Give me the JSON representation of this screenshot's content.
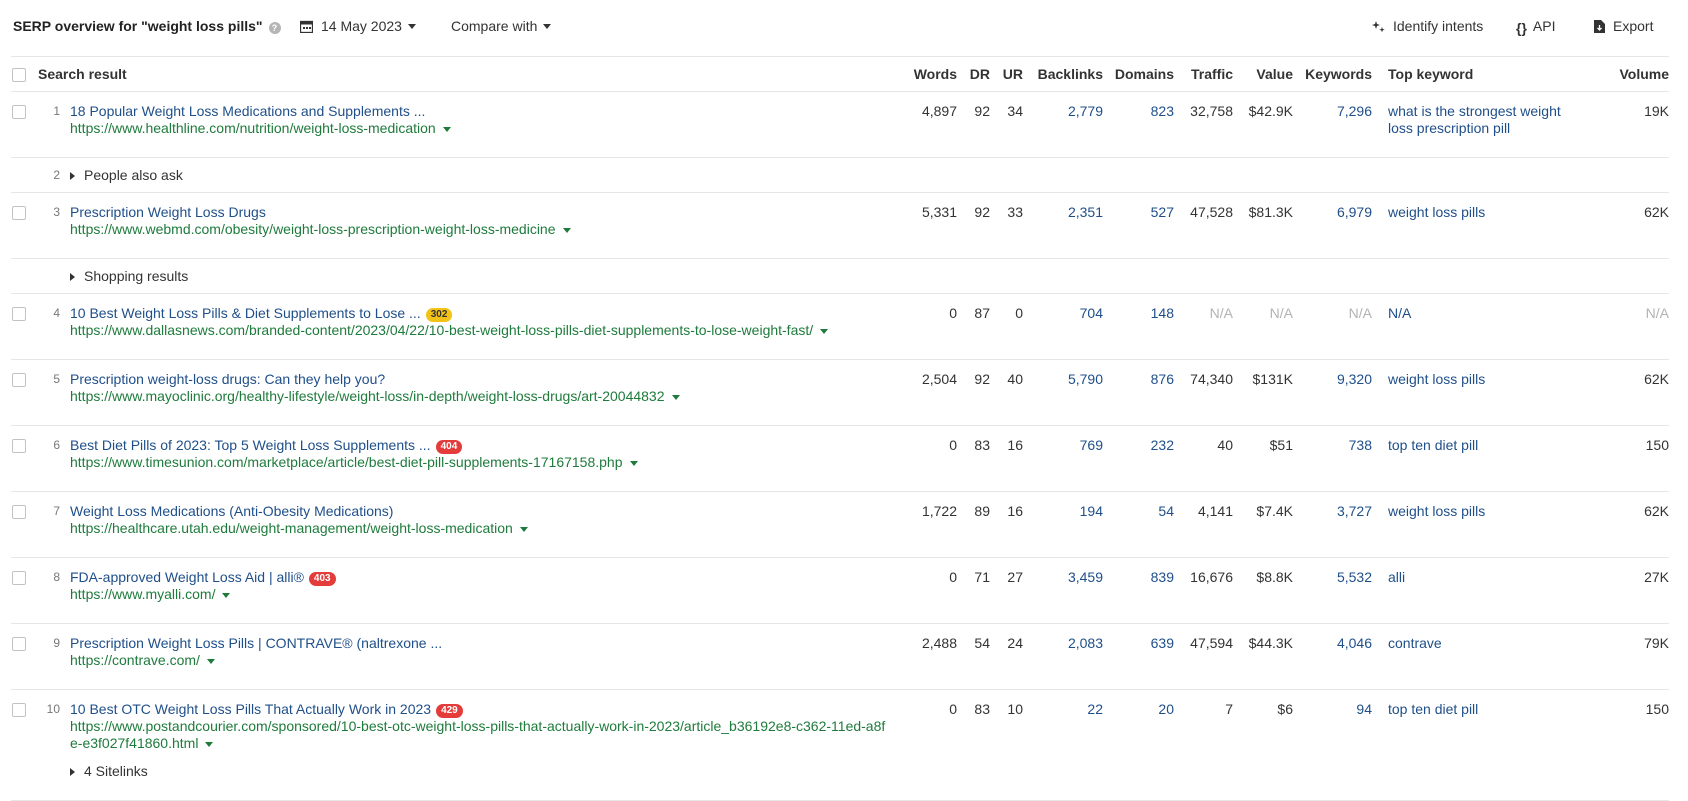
{
  "toolbar": {
    "title": "SERP overview for \"weight loss pills\"",
    "help": "?",
    "date": "14 May 2023",
    "compare": "Compare with",
    "identify": "Identify intents",
    "api": "API",
    "export": "Export"
  },
  "columns": {
    "result": "Search result",
    "words": "Words",
    "dr": "DR",
    "ur": "UR",
    "backlinks": "Backlinks",
    "domains": "Domains",
    "traffic": "Traffic",
    "value": "Value",
    "keywords": "Keywords",
    "top_keyword": "Top keyword",
    "volume": "Volume"
  },
  "rows": [
    {
      "num": "1",
      "title": "18 Popular Weight Loss Medications and Supplements ...",
      "url": "https://www.healthline.com/nutrition/weight-loss-medication",
      "words": "4,897",
      "dr": "92",
      "ur": "34",
      "backlinks": "2,779",
      "domains": "823",
      "traffic": "32,758",
      "value": "$42.9K",
      "keywords": "7,296",
      "top_keyword": "what is the strongest weight loss prescription pill",
      "volume": "19K"
    },
    {
      "num": "2",
      "label": "People also ask"
    },
    {
      "num": "3",
      "title": "Prescription Weight Loss Drugs",
      "url": "https://www.webmd.com/obesity/weight-loss-prescription-weight-loss-medicine",
      "words": "5,331",
      "dr": "92",
      "ur": "33",
      "backlinks": "2,351",
      "domains": "527",
      "traffic": "47,528",
      "value": "$81.3K",
      "keywords": "6,979",
      "top_keyword": "weight loss pills",
      "volume": "62K"
    },
    {
      "num": "",
      "label": "Shopping results"
    },
    {
      "num": "4",
      "title": "10 Best Weight Loss Pills & Diet Supplements to Lose ...",
      "badge": "302",
      "url": "https://www.dallasnews.com/branded-content/2023/04/22/10-best-weight-loss-pills-diet-supplements-to-lose-weight-fast/",
      "words": "0",
      "dr": "87",
      "ur": "0",
      "backlinks": "704",
      "domains": "148",
      "traffic": "N/A",
      "value": "N/A",
      "keywords": "N/A",
      "top_keyword": "N/A",
      "volume": "N/A"
    },
    {
      "num": "5",
      "title": "Prescription weight-loss drugs: Can they help you?",
      "url": "https://www.mayoclinic.org/healthy-lifestyle/weight-loss/in-depth/weight-loss-drugs/art-20044832",
      "words": "2,504",
      "dr": "92",
      "ur": "40",
      "backlinks": "5,790",
      "domains": "876",
      "traffic": "74,340",
      "value": "$131K",
      "keywords": "9,320",
      "top_keyword": "weight loss pills",
      "volume": "62K"
    },
    {
      "num": "6",
      "title": "Best Diet Pills of 2023: Top 5 Weight Loss Supplements ...",
      "badge": "404",
      "url": "https://www.timesunion.com/marketplace/article/best-diet-pill-supplements-17167158.php",
      "words": "0",
      "dr": "83",
      "ur": "16",
      "backlinks": "769",
      "domains": "232",
      "traffic": "40",
      "value": "$51",
      "keywords": "738",
      "top_keyword": "top ten diet pill",
      "volume": "150"
    },
    {
      "num": "7",
      "title": "Weight Loss Medications (Anti-Obesity Medications)",
      "url": "https://healthcare.utah.edu/weight-management/weight-loss-medication",
      "words": "1,722",
      "dr": "89",
      "ur": "16",
      "backlinks": "194",
      "domains": "54",
      "traffic": "4,141",
      "value": "$7.4K",
      "keywords": "3,727",
      "top_keyword": "weight loss pills",
      "volume": "62K"
    },
    {
      "num": "8",
      "title": "FDA-approved Weight Loss Aid | alli®",
      "badge": "403",
      "url": "https://www.myalli.com/",
      "words": "0",
      "dr": "71",
      "ur": "27",
      "backlinks": "3,459",
      "domains": "839",
      "traffic": "16,676",
      "value": "$8.8K",
      "keywords": "5,532",
      "top_keyword": "alli",
      "volume": "27K"
    },
    {
      "num": "9",
      "title": "Prescription Weight Loss Pills | CONTRAVE® (naltrexone ...",
      "url": "https://contrave.com/",
      "words": "2,488",
      "dr": "54",
      "ur": "24",
      "backlinks": "2,083",
      "domains": "639",
      "traffic": "47,594",
      "value": "$44.3K",
      "keywords": "4,046",
      "top_keyword": "contrave",
      "volume": "79K"
    },
    {
      "num": "10",
      "title": "10 Best OTC Weight Loss Pills That Actually Work in 2023",
      "badge": "429",
      "url": "https://www.postandcourier.com/sponsored/10-best-otc-weight-loss-pills-that-actually-work-in-2023/article_b36192e8-c362-11ed-a8fe-e3f027f41860.html",
      "sitelinks": "4 Sitelinks",
      "words": "0",
      "dr": "83",
      "ur": "10",
      "backlinks": "22",
      "domains": "20",
      "traffic": "7",
      "value": "$6",
      "keywords": "94",
      "top_keyword": "top ten diet pill",
      "volume": "150"
    }
  ]
}
